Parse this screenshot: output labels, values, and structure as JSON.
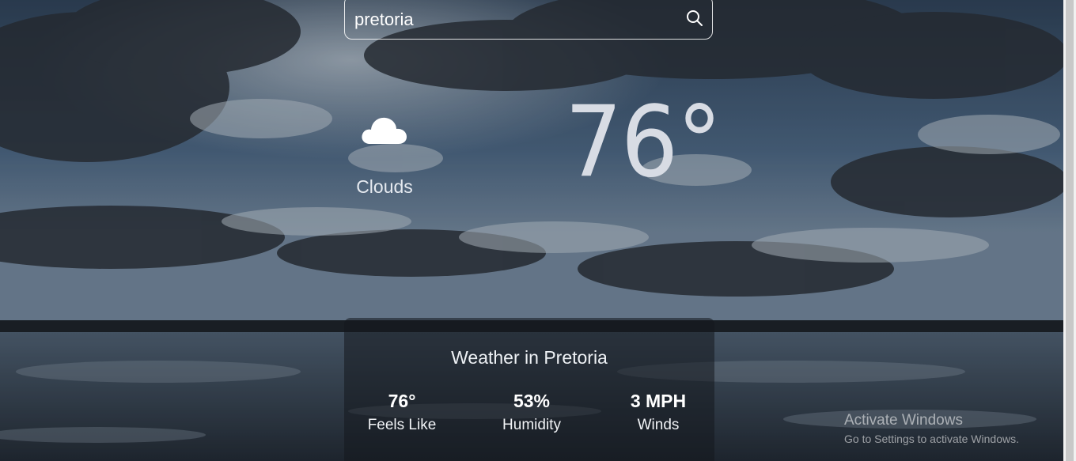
{
  "search": {
    "value": "pretoria",
    "icon": "search-icon"
  },
  "current": {
    "icon": "cloud-icon",
    "condition": "Clouds",
    "temperature": "76°"
  },
  "details": {
    "title": "Weather in Pretoria",
    "stats": [
      {
        "value": "76°",
        "label": "Feels Like"
      },
      {
        "value": "53%",
        "label": "Humidity"
      },
      {
        "value": "3 MPH",
        "label": "Winds"
      }
    ]
  },
  "watermark": {
    "title": "Activate Windows",
    "subtitle": "Go to Settings to activate Windows."
  },
  "colors": {
    "sky_top": "#3f5670",
    "water": "#2c3440",
    "text": "#ffffff"
  }
}
